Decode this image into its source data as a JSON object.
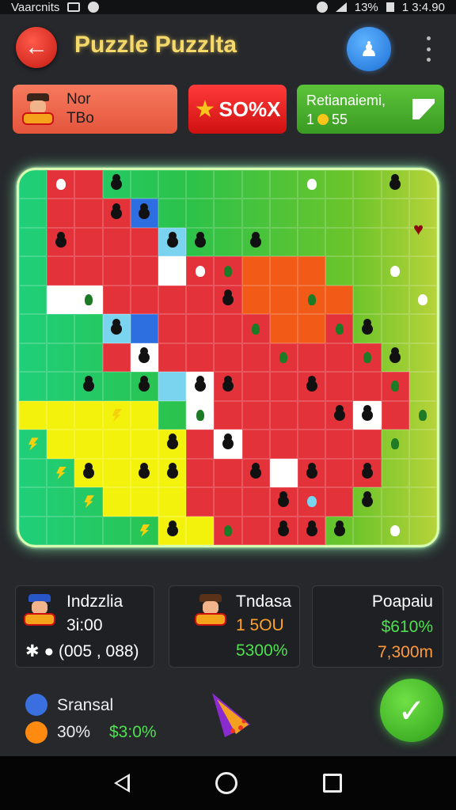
{
  "status_bar": {
    "carrier": "Vaarcnits",
    "battery": "13%",
    "time": "1 3:4.90"
  },
  "header": {
    "title": "Puzzle Puzzlta"
  },
  "player_card": {
    "line1": "Nor",
    "line2": "TBo"
  },
  "score_card": {
    "value": "SO%X"
  },
  "time_card": {
    "label": "Retianaiemi,",
    "value_prefix": "1",
    "value": "55"
  },
  "panels": [
    {
      "name": "Indzzlia",
      "sub": "3i:00",
      "foot": "(005 , 088)"
    },
    {
      "name": "Tndasa",
      "sub": "1  5OU",
      "foot": "5300%"
    },
    {
      "name": "Poapaiu",
      "sub": "$610%",
      "foot": "7,300m"
    }
  ],
  "legend": {
    "name": "Sransal",
    "pct": "30%",
    "amount": "$3:0%"
  },
  "colors": {
    "accent_green": "#4fe04f",
    "accent_orange": "#ff9a3a",
    "title_yellow": "#f5d86a",
    "board_red": "#e3323a",
    "board_yellow": "#f3f20c"
  },
  "board": {
    "rows": [
      ". r r . . . . . . . . . . . .",
      ". r r r b . . . . . . . . . .",
      ". r r r r c . . . . . . . . .",
      ". r r r r w r r o o o . . . .",
      ". w w r r r r r o o o o . . .",
      ". . . c b r r r r o o r . . .",
      ". . . r w r r r r r r r r . .",
      ". . . . . c w r r r r r r r .",
      "y y y y y . w r r r r r w r .",
      ". y y y y y r w r r r r r . .",
      ". . y y y y r r r w r r r . .",
      ". . . y y y r r r r r r . . .",
      ". . . . . y y r r r r . . . ."
    ],
    "pieces": [
      {
        "r": 0,
        "c": 1,
        "t": "wh"
      },
      {
        "r": 0,
        "c": 3,
        "t": "k"
      },
      {
        "r": 0,
        "c": 10,
        "t": "wh"
      },
      {
        "r": 0,
        "c": 13,
        "t": "k"
      },
      {
        "r": 1,
        "c": 3,
        "t": "k"
      },
      {
        "r": 1,
        "c": 4,
        "t": "k"
      },
      {
        "r": 2,
        "c": 1,
        "t": "k"
      },
      {
        "r": 2,
        "c": 5,
        "t": "k"
      },
      {
        "r": 2,
        "c": 8,
        "t": "k"
      },
      {
        "r": 2,
        "c": 6,
        "t": "k"
      },
      {
        "r": 3,
        "c": 6,
        "t": "wh"
      },
      {
        "r": 3,
        "c": 7,
        "t": "g"
      },
      {
        "r": 3,
        "c": 13,
        "t": "wh"
      },
      {
        "r": 4,
        "c": 2,
        "t": "g"
      },
      {
        "r": 4,
        "c": 7,
        "t": "k"
      },
      {
        "r": 4,
        "c": 10,
        "t": "g"
      },
      {
        "r": 4,
        "c": 14,
        "t": "wh"
      },
      {
        "r": 5,
        "c": 3,
        "t": "k"
      },
      {
        "r": 5,
        "c": 8,
        "t": "g"
      },
      {
        "r": 5,
        "c": 11,
        "t": "g"
      },
      {
        "r": 5,
        "c": 12,
        "t": "k"
      },
      {
        "r": 6,
        "c": 4,
        "t": "k"
      },
      {
        "r": 6,
        "c": 9,
        "t": "g"
      },
      {
        "r": 6,
        "c": 12,
        "t": "g"
      },
      {
        "r": 6,
        "c": 13,
        "t": "k"
      },
      {
        "r": 7,
        "c": 2,
        "t": "k"
      },
      {
        "r": 7,
        "c": 4,
        "t": "k"
      },
      {
        "r": 7,
        "c": 6,
        "t": "k"
      },
      {
        "r": 7,
        "c": 7,
        "t": "k"
      },
      {
        "r": 7,
        "c": 10,
        "t": "k"
      },
      {
        "r": 7,
        "c": 13,
        "t": "g"
      },
      {
        "r": 8,
        "c": 3,
        "t": "bolt"
      },
      {
        "r": 8,
        "c": 6,
        "t": "g"
      },
      {
        "r": 8,
        "c": 11,
        "t": "k"
      },
      {
        "r": 8,
        "c": 12,
        "t": "k"
      },
      {
        "r": 8,
        "c": 14,
        "t": "g"
      },
      {
        "r": 9,
        "c": 0,
        "t": "bolt"
      },
      {
        "r": 9,
        "c": 5,
        "t": "k"
      },
      {
        "r": 9,
        "c": 7,
        "t": "k"
      },
      {
        "r": 9,
        "c": 13,
        "t": "g"
      },
      {
        "r": 10,
        "c": 1,
        "t": "bolt"
      },
      {
        "r": 10,
        "c": 2,
        "t": "k"
      },
      {
        "r": 10,
        "c": 4,
        "t": "k"
      },
      {
        "r": 10,
        "c": 5,
        "t": "k"
      },
      {
        "r": 10,
        "c": 8,
        "t": "k"
      },
      {
        "r": 10,
        "c": 10,
        "t": "k"
      },
      {
        "r": 10,
        "c": 12,
        "t": "k"
      },
      {
        "r": 11,
        "c": 2,
        "t": "bolt"
      },
      {
        "r": 11,
        "c": 9,
        "t": "k"
      },
      {
        "r": 11,
        "c": 10,
        "t": "c"
      },
      {
        "r": 11,
        "c": 12,
        "t": "k"
      },
      {
        "r": 12,
        "c": 4,
        "t": "bolt"
      },
      {
        "r": 12,
        "c": 5,
        "t": "k"
      },
      {
        "r": 12,
        "c": 7,
        "t": "g"
      },
      {
        "r": 12,
        "c": 9,
        "t": "k"
      },
      {
        "r": 12,
        "c": 10,
        "t": "k"
      },
      {
        "r": 12,
        "c": 11,
        "t": "k"
      },
      {
        "r": 12,
        "c": 13,
        "t": "wh"
      }
    ]
  }
}
